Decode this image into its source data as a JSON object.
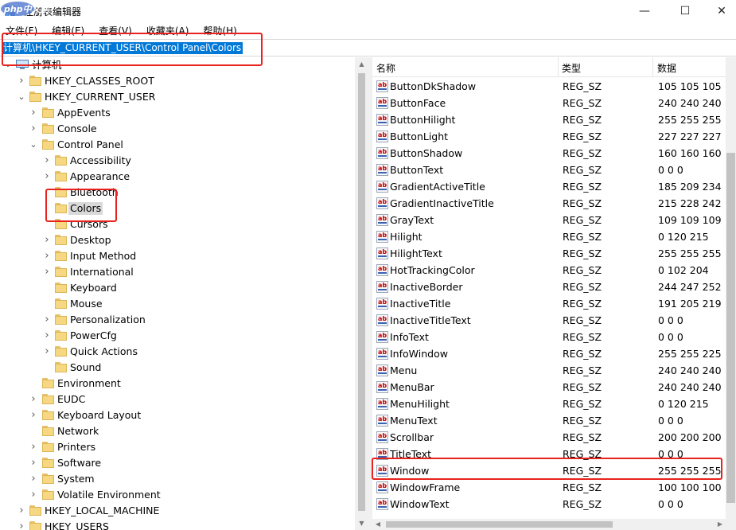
{
  "window": {
    "title": "注册表编辑器",
    "minimize_glyph": "—",
    "maximize_glyph": "☐",
    "close_glyph": "✕",
    "watermark": "php中文网"
  },
  "menu": [
    "文件(F)",
    "编辑(E)",
    "查看(V)",
    "收藏夹(A)",
    "帮助(H)"
  ],
  "address": {
    "path": "计算机\\HKEY_CURRENT_USER\\Control Panel\\Colors"
  },
  "tree": {
    "root_label": "计算机",
    "nodes": [
      {
        "label": "HKEY_CLASSES_ROOT",
        "level": 1,
        "expander": "collapsed"
      },
      {
        "label": "HKEY_CURRENT_USER",
        "level": 1,
        "expander": "expanded"
      },
      {
        "label": "AppEvents",
        "level": 2,
        "expander": "collapsed"
      },
      {
        "label": "Console",
        "level": 2,
        "expander": "collapsed"
      },
      {
        "label": "Control Panel",
        "level": 2,
        "expander": "expanded"
      },
      {
        "label": "Accessibility",
        "level": 3,
        "expander": "collapsed"
      },
      {
        "label": "Appearance",
        "level": 3,
        "expander": "collapsed"
      },
      {
        "label": "Bluetooth",
        "level": 3,
        "expander": "none"
      },
      {
        "label": "Colors",
        "level": 3,
        "expander": "none",
        "selected": true
      },
      {
        "label": "Cursors",
        "level": 3,
        "expander": "none"
      },
      {
        "label": "Desktop",
        "level": 3,
        "expander": "collapsed"
      },
      {
        "label": "Input Method",
        "level": 3,
        "expander": "collapsed"
      },
      {
        "label": "International",
        "level": 3,
        "expander": "collapsed"
      },
      {
        "label": "Keyboard",
        "level": 3,
        "expander": "none"
      },
      {
        "label": "Mouse",
        "level": 3,
        "expander": "none"
      },
      {
        "label": "Personalization",
        "level": 3,
        "expander": "collapsed"
      },
      {
        "label": "PowerCfg",
        "level": 3,
        "expander": "collapsed"
      },
      {
        "label": "Quick Actions",
        "level": 3,
        "expander": "collapsed"
      },
      {
        "label": "Sound",
        "level": 3,
        "expander": "none"
      },
      {
        "label": "Environment",
        "level": 2,
        "expander": "none"
      },
      {
        "label": "EUDC",
        "level": 2,
        "expander": "collapsed"
      },
      {
        "label": "Keyboard Layout",
        "level": 2,
        "expander": "collapsed"
      },
      {
        "label": "Network",
        "level": 2,
        "expander": "none"
      },
      {
        "label": "Printers",
        "level": 2,
        "expander": "collapsed"
      },
      {
        "label": "Software",
        "level": 2,
        "expander": "collapsed"
      },
      {
        "label": "System",
        "level": 2,
        "expander": "collapsed"
      },
      {
        "label": "Volatile Environment",
        "level": 2,
        "expander": "collapsed"
      },
      {
        "label": "HKEY_LOCAL_MACHINE",
        "level": 1,
        "expander": "collapsed"
      },
      {
        "label": "HKEY_USERS",
        "level": 1,
        "expander": "collapsed"
      }
    ]
  },
  "list": {
    "columns": {
      "name": "名称",
      "type": "类型",
      "data": "数据"
    },
    "icon_text": "ab",
    "rows": [
      {
        "name": "ButtonDkShadow",
        "type": "REG_SZ",
        "data": "105 105 105"
      },
      {
        "name": "ButtonFace",
        "type": "REG_SZ",
        "data": "240 240 240"
      },
      {
        "name": "ButtonHilight",
        "type": "REG_SZ",
        "data": "255 255 255"
      },
      {
        "name": "ButtonLight",
        "type": "REG_SZ",
        "data": "227 227 227"
      },
      {
        "name": "ButtonShadow",
        "type": "REG_SZ",
        "data": "160 160 160"
      },
      {
        "name": "ButtonText",
        "type": "REG_SZ",
        "data": "0 0 0"
      },
      {
        "name": "GradientActiveTitle",
        "type": "REG_SZ",
        "data": "185 209 234"
      },
      {
        "name": "GradientInactiveTitle",
        "type": "REG_SZ",
        "data": "215 228 242"
      },
      {
        "name": "GrayText",
        "type": "REG_SZ",
        "data": "109 109 109"
      },
      {
        "name": "Hilight",
        "type": "REG_SZ",
        "data": "0 120 215"
      },
      {
        "name": "HilightText",
        "type": "REG_SZ",
        "data": "255 255 255"
      },
      {
        "name": "HotTrackingColor",
        "type": "REG_SZ",
        "data": "0 102 204"
      },
      {
        "name": "InactiveBorder",
        "type": "REG_SZ",
        "data": "244 247 252"
      },
      {
        "name": "InactiveTitle",
        "type": "REG_SZ",
        "data": "191 205 219"
      },
      {
        "name": "InactiveTitleText",
        "type": "REG_SZ",
        "data": "0 0 0"
      },
      {
        "name": "InfoText",
        "type": "REG_SZ",
        "data": "0 0 0"
      },
      {
        "name": "InfoWindow",
        "type": "REG_SZ",
        "data": "255 255 225"
      },
      {
        "name": "Menu",
        "type": "REG_SZ",
        "data": "240 240 240"
      },
      {
        "name": "MenuBar",
        "type": "REG_SZ",
        "data": "240 240 240"
      },
      {
        "name": "MenuHilight",
        "type": "REG_SZ",
        "data": "0 120 215"
      },
      {
        "name": "MenuText",
        "type": "REG_SZ",
        "data": "0 0 0"
      },
      {
        "name": "Scrollbar",
        "type": "REG_SZ",
        "data": "200 200 200"
      },
      {
        "name": "TitleText",
        "type": "REG_SZ",
        "data": "0 0 0"
      },
      {
        "name": "Window",
        "type": "REG_SZ",
        "data": "255 255 255"
      },
      {
        "name": "WindowFrame",
        "type": "REG_SZ",
        "data": "100 100 100"
      },
      {
        "name": "WindowText",
        "type": "REG_SZ",
        "data": "0 0 0"
      }
    ]
  },
  "colors": {
    "selection_blue": "#0078d7",
    "annotation_red": "#e8221c",
    "tree_selected": "#d9d9d9"
  }
}
